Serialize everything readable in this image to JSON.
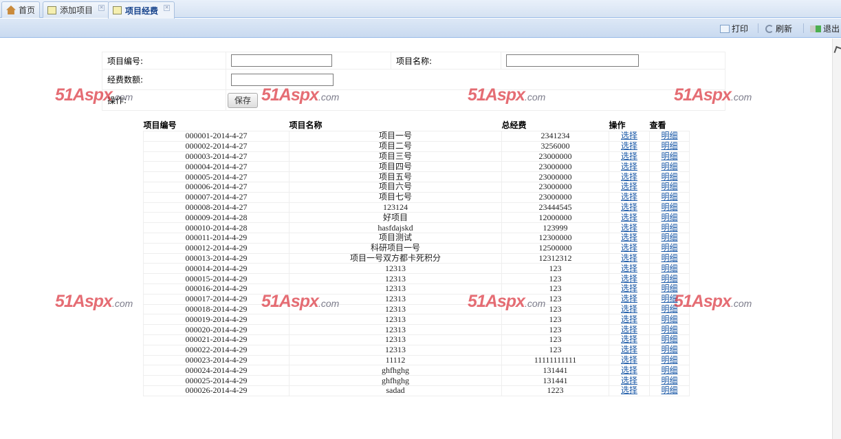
{
  "tabs": [
    {
      "label": "首页",
      "icon": "home-icon"
    },
    {
      "label": "添加项目",
      "icon": "form-icon",
      "closable": true
    },
    {
      "label": "项目经费",
      "icon": "form-icon",
      "closable": true,
      "active": true
    }
  ],
  "toolbar": {
    "print": "打印",
    "refresh": "刷新",
    "exit": "退出"
  },
  "form": {
    "project_no_label": "项目编号:",
    "project_name_label": "项目名称:",
    "amount_label": "经费数额:",
    "operation_label": "操作:",
    "project_no_value": "",
    "project_name_value": "",
    "amount_value": "",
    "save_label": "保存"
  },
  "watermark": {
    "main": "51Aspx",
    "suffix": ".com"
  },
  "grid": {
    "headers": [
      "项目编号",
      "项目名称",
      "总经费",
      "操作",
      "查看"
    ],
    "select_label": "选择",
    "detail_label": "明细",
    "rows": [
      [
        "000001-2014-4-27",
        "项目一号",
        "2341234"
      ],
      [
        "000002-2014-4-27",
        "项目二号",
        "3256000"
      ],
      [
        "000003-2014-4-27",
        "项目三号",
        "23000000"
      ],
      [
        "000004-2014-4-27",
        "项目四号",
        "23000000"
      ],
      [
        "000005-2014-4-27",
        "项目五号",
        "23000000"
      ],
      [
        "000006-2014-4-27",
        "项目六号",
        "23000000"
      ],
      [
        "000007-2014-4-27",
        "项目七号",
        "23000000"
      ],
      [
        "000008-2014-4-27",
        "123124",
        "23444545"
      ],
      [
        "000009-2014-4-28",
        "好项目",
        "12000000"
      ],
      [
        "000010-2014-4-28",
        "hasfdajskd",
        "123999"
      ],
      [
        "000011-2014-4-29",
        "项目测试",
        "12300000"
      ],
      [
        "000012-2014-4-29",
        "科研项目一号",
        "12500000"
      ],
      [
        "000013-2014-4-29",
        "项目一号双方都卡死积分",
        "12312312"
      ],
      [
        "000014-2014-4-29",
        "12313",
        "123"
      ],
      [
        "000015-2014-4-29",
        "12313",
        "123"
      ],
      [
        "000016-2014-4-29",
        "12313",
        "123"
      ],
      [
        "000017-2014-4-29",
        "12313",
        "123"
      ],
      [
        "000018-2014-4-29",
        "12313",
        "123"
      ],
      [
        "000019-2014-4-29",
        "12313",
        "123"
      ],
      [
        "000020-2014-4-29",
        "12313",
        "123"
      ],
      [
        "000021-2014-4-29",
        "12313",
        "123"
      ],
      [
        "000022-2014-4-29",
        "12313",
        "123"
      ],
      [
        "000023-2014-4-29",
        "11112",
        "11111111111"
      ],
      [
        "000024-2014-4-29",
        "ghfhghg",
        "131441"
      ],
      [
        "000025-2014-4-29",
        "ghfhghg",
        "131441"
      ],
      [
        "000026-2014-4-29",
        "sadad",
        "1223"
      ]
    ]
  }
}
